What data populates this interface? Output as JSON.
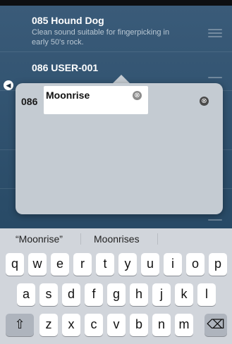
{
  "list": {
    "items": [
      {
        "title": "085 Hound Dog",
        "desc_line1": "Clean sound suitable for fingerpicking in",
        "desc_line2": "early 50's rock."
      },
      {
        "title": "086 USER-001"
      }
    ],
    "speaker_icon": "speaker-icon"
  },
  "popover": {
    "number": "086",
    "name_value": "Moonrise",
    "clear_icon": "⊗"
  },
  "keyboard": {
    "suggestions": [
      "“Moonrise”",
      "Moonrises",
      ""
    ],
    "row1": [
      "q",
      "w",
      "e",
      "r",
      "t",
      "y",
      "u",
      "i",
      "o",
      "p"
    ],
    "row2": [
      "a",
      "s",
      "d",
      "f",
      "g",
      "h",
      "j",
      "k",
      "l"
    ],
    "row3": [
      "z",
      "x",
      "c",
      "v",
      "b",
      "n",
      "m"
    ],
    "shift_icon": "⇧",
    "delete_icon": "⌫"
  }
}
